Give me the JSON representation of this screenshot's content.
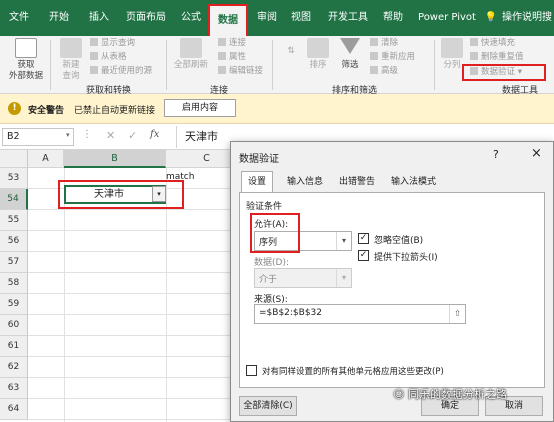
{
  "menubar": {
    "tabs": [
      "文件",
      "开始",
      "插入",
      "页面布局",
      "公式",
      "数据",
      "审阅",
      "视图",
      "开发工具",
      "帮助",
      "Power Pivot"
    ],
    "active_tab": "数据",
    "tell_me": "操作说明搜"
  },
  "ribbon": {
    "get_external": "获取\n外部数据",
    "new_query": "新建\n查询",
    "show_queries": "显示查询",
    "from_table": "从表格",
    "recent_sources": "最近使用的源",
    "group_get_transform": "获取和转换",
    "refresh_all": "全部刷新",
    "connections": "连接",
    "properties": "属性",
    "edit_links": "编辑链接",
    "group_connections": "连接",
    "sort": "排序",
    "filter": "筛选",
    "clear": "清除",
    "reapply": "重新应用",
    "advanced": "高级",
    "group_sort_filter": "排序和筛选",
    "split_columns": "分列",
    "flash_fill": "快速填充",
    "remove_duplicates": "删除重复值",
    "data_validation": "数据验证",
    "group_data_tools": "数据工具"
  },
  "security": {
    "title": "安全警告",
    "message": "已禁止自动更新链接",
    "enable_button": "启用内容"
  },
  "formula_bar": {
    "name_box": "B2",
    "fx": "fx",
    "value": "天津市"
  },
  "sheet": {
    "columns": [
      "A",
      "B",
      "C"
    ],
    "rows": [
      "53",
      "54",
      "55",
      "56",
      "57",
      "58",
      "59",
      "60",
      "61",
      "62",
      "63",
      "64"
    ],
    "c53_text": "match",
    "b54_value": "天津市"
  },
  "dialog": {
    "title": "数据验证",
    "help": "?",
    "close": "×",
    "tabs": [
      "设置",
      "输入信息",
      "出错警告",
      "输入法模式"
    ],
    "criteria_label": "验证条件",
    "allow_label": "允许(A):",
    "allow_value": "序列",
    "ignore_blank": "忽略空值(B)",
    "dropdown": "提供下拉箭头(I)",
    "data_label": "数据(D):",
    "data_value": "介于",
    "source_label": "来源(S):",
    "source_value": "=$B$2:$B$32",
    "apply_all": "对有同样设置的所有其他单元格应用这些更改(P)",
    "clear_all": "全部清除(C)",
    "ok": "确定",
    "cancel": "取消"
  },
  "watermark": "同乐的数据分析之路",
  "colors": {
    "excel_green": "#217346",
    "highlight_red": "#e02020",
    "warning_bg": "#fff4ce"
  }
}
